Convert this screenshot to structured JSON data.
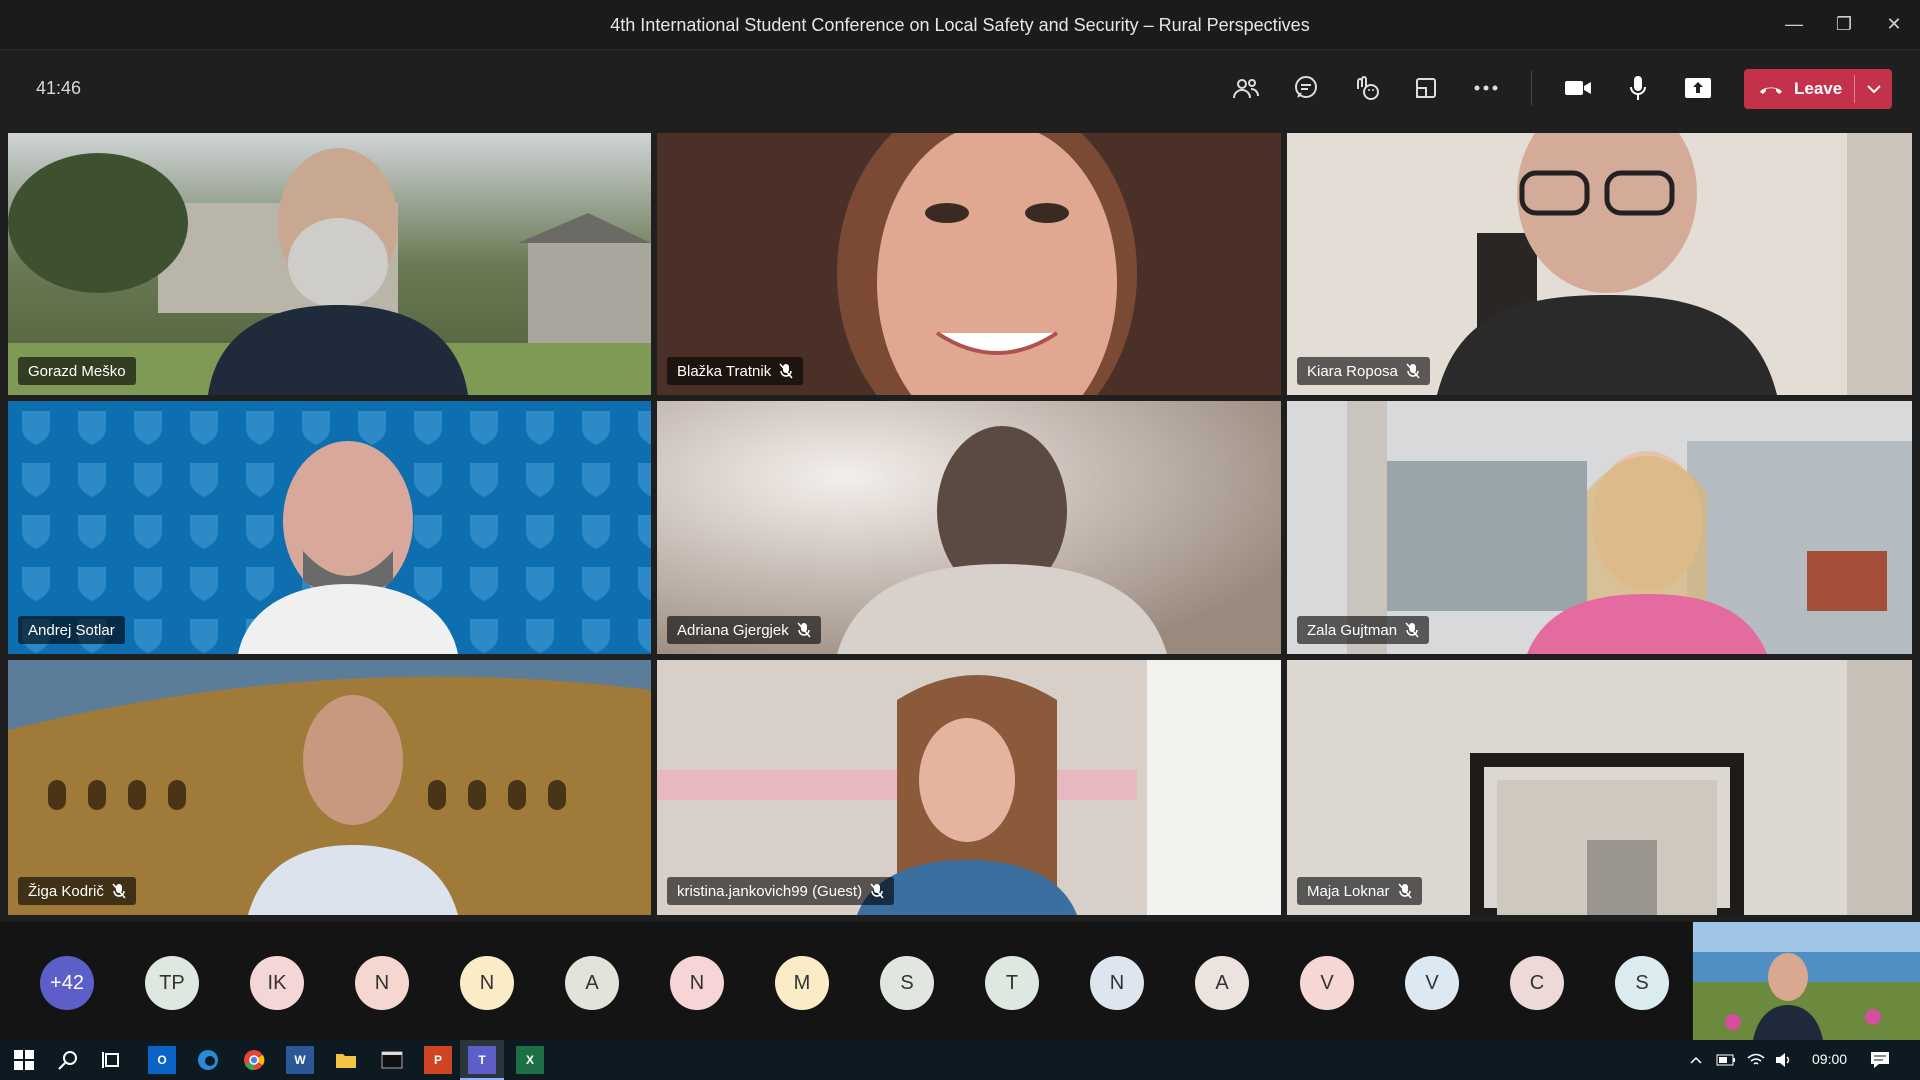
{
  "window": {
    "title": "4th International Student Conference on Local Safety and Security – Rural Perspectives",
    "controls": [
      "minimize-icon",
      "restore-icon",
      "close-icon"
    ]
  },
  "meeting": {
    "elapsed_time": "41:46",
    "toolbar_icons": [
      "participants-icon",
      "chat-icon",
      "reactions-icon",
      "rooms-icon",
      "more-options-icon",
      "camera-icon",
      "microphone-icon",
      "share-icon"
    ],
    "leave_label": "Leave",
    "leave_color": "#c4314b"
  },
  "participants": [
    {
      "name": "Gorazd Meško",
      "muted": false,
      "bg": "#5c6b4e"
    },
    {
      "name": "Blažka Tratnik",
      "muted": true,
      "bg": "#7a5040"
    },
    {
      "name": "Kiara Roposa",
      "muted": true,
      "bg": "#d9d2c9"
    },
    {
      "name": "Andrej Sotlar",
      "muted": false,
      "bg": "#0e6fb0"
    },
    {
      "name": "Adriana Gjergjek",
      "muted": true,
      "bg": "#a6968c"
    },
    {
      "name": "Zala Gujtman",
      "muted": true,
      "bg": "#bfc4c8"
    },
    {
      "name": "Žiga Kodrič",
      "muted": true,
      "bg": "#8a6a2e"
    },
    {
      "name": "kristina.jankovich99 (Guest)",
      "muted": true,
      "bg": "#d8cfc8"
    },
    {
      "name": "Maja Loknar",
      "muted": true,
      "bg": "#dcd7d1"
    }
  ],
  "roster": [
    {
      "initials": "+42",
      "color": "#5b5fc7",
      "fg": "#ffffff"
    },
    {
      "initials": "TP",
      "color": "#dfe8e0",
      "fg": "#333333"
    },
    {
      "initials": "IK",
      "color": "#f4d6d6",
      "fg": "#333333"
    },
    {
      "initials": "N",
      "color": "#f6d7cf",
      "fg": "#333333"
    },
    {
      "initials": "N",
      "color": "#fbecc8",
      "fg": "#333333"
    },
    {
      "initials": "A",
      "color": "#e3e3dc",
      "fg": "#333333"
    },
    {
      "initials": "N",
      "color": "#f7d4d6",
      "fg": "#333333"
    },
    {
      "initials": "M",
      "color": "#fbecc8",
      "fg": "#333333"
    },
    {
      "initials": "S",
      "color": "#e2e6e0",
      "fg": "#333333"
    },
    {
      "initials": "T",
      "color": "#dde8e0",
      "fg": "#333333"
    },
    {
      "initials": "N",
      "color": "#dde5ee",
      "fg": "#333333"
    },
    {
      "initials": "A",
      "color": "#ece3df",
      "fg": "#333333"
    },
    {
      "initials": "V",
      "color": "#f7d7d6",
      "fg": "#333333"
    },
    {
      "initials": "V",
      "color": "#dce9f2",
      "fg": "#333333"
    },
    {
      "initials": "C",
      "color": "#ecd9d8",
      "fg": "#333333"
    },
    {
      "initials": "S",
      "color": "#dbecf0",
      "fg": "#333333"
    }
  ],
  "taskbar": {
    "apps": [
      "windows-start-icon",
      "search-icon",
      "task-view-icon",
      "outlook-icon",
      "edge-icon",
      "chrome-icon",
      "word-icon",
      "file-explorer-icon",
      "terminal-icon",
      "powerpoint-icon",
      "teams-icon",
      "excel-icon"
    ],
    "time": "09:00"
  }
}
